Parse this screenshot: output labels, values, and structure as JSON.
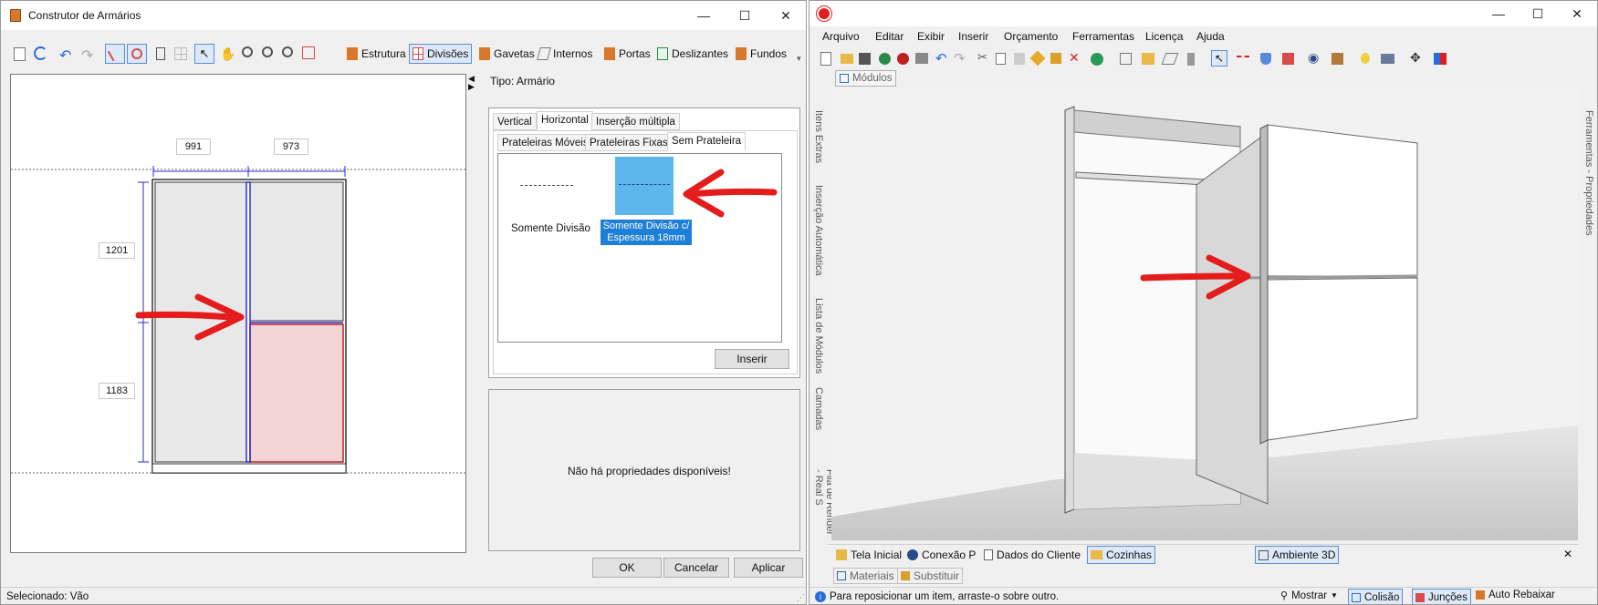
{
  "left_window": {
    "title": "Construtor de Armários",
    "controls": {
      "minimize": "—",
      "maximize": "☐",
      "close": "✕"
    },
    "tabs": [
      {
        "label": "Estrutura",
        "icon": "cabinet-icon",
        "color": "#d9782b"
      },
      {
        "label": "Divisões",
        "icon": "grid-icon",
        "color": "#d94a4a",
        "selected": true
      },
      {
        "label": "Gavetas",
        "icon": "drawer-icon",
        "color": "#d9782b"
      },
      {
        "label": "Internos",
        "icon": "internals-icon",
        "color": "#7a7a7a"
      },
      {
        "label": "Portas",
        "icon": "door-icon",
        "color": "#d9782b"
      },
      {
        "label": "Deslizantes",
        "icon": "sliding-door-icon",
        "color": "#2a8a4a"
      },
      {
        "label": "Fundos",
        "icon": "back-panel-icon",
        "color": "#d9782b"
      }
    ],
    "drawing": {
      "dim_top_left": "991",
      "dim_top_right": "973",
      "dim_left_top": "1201",
      "dim_left_bottom": "1183"
    },
    "type_label": "Tipo: Armário",
    "division_tabs": [
      "Vertical",
      "Horizontal",
      "Inserção múltipla"
    ],
    "shelf_tabs": [
      "Prateleiras Móveis",
      "Prateleiras Fixas",
      "Sem Prateleira"
    ],
    "options": [
      {
        "label": "Somente Divisão"
      },
      {
        "label_line1": "Somente Divisão c/",
        "label_line2": "Espessura 18mm",
        "selected": true
      }
    ],
    "insert_button": "Inserir",
    "no_properties": "Não há propriedades disponíveis!",
    "buttons": {
      "ok": "OK",
      "cancel": "Cancelar",
      "apply": "Aplicar"
    },
    "status": "Selecionado: Vão",
    "colors": {
      "selection_blue": "#1e7fd8",
      "highlight_red": "#f2d4d4",
      "panel_gray": "#e8e8e8",
      "arrow_red": "#e51c1c"
    }
  },
  "right_window": {
    "menu": [
      "Arquivo",
      "Editar",
      "Exibir",
      "Inserir",
      "Orçamento",
      "Ferramentas",
      "Licença",
      "Ajuda"
    ],
    "doc_tab": "Módulos",
    "side_tabs_left": [
      "Itens Extras",
      "Inserção Automática",
      "Lista de Módulos",
      "Camadas",
      "Fila de Render - Real S"
    ],
    "side_tab_right": "Ferramentas - Propriedades",
    "bottom_tabs": [
      {
        "label": "Tela Inicial",
        "icon": "home-icon"
      },
      {
        "label": "Conexão P",
        "icon": "connection-icon"
      },
      {
        "label": "Dados do Cliente",
        "icon": "document-icon"
      },
      {
        "label": "Cozinhas",
        "icon": "folder-icon",
        "selected": true
      },
      {
        "label": "Ambiente 3D",
        "icon": "cube-icon",
        "selected": true
      }
    ],
    "lower_tabs": [
      {
        "label": "Materiais",
        "icon": "materials-icon"
      },
      {
        "label": "Substituir",
        "icon": "replace-icon"
      }
    ],
    "status_hint": "Para reposicionar um item, arraste-o sobre outro.",
    "status_items": [
      {
        "label": "Mostrar",
        "icon": "bike-icon"
      },
      {
        "label": "Colisão",
        "icon": "collision-icon",
        "selected": true
      },
      {
        "label": "Junções",
        "icon": "joints-icon",
        "selected": true
      },
      {
        "label": "Auto Rebaixar",
        "icon": "auto-lower-icon"
      }
    ],
    "controls": {
      "minimize": "—",
      "maximize": "☐",
      "close": "✕"
    }
  }
}
